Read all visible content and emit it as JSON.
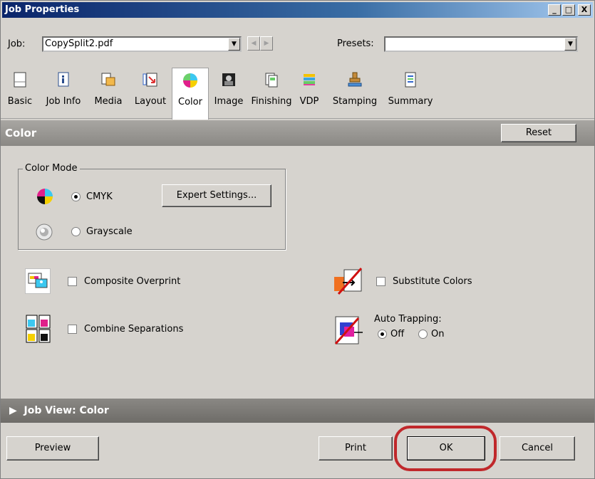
{
  "window": {
    "title": "Job Properties",
    "minimize": "_",
    "maximize": "□",
    "close": "X"
  },
  "job": {
    "label": "Job:",
    "value": "CopySplit2.pdf"
  },
  "presets": {
    "label": "Presets:",
    "value": ""
  },
  "tabs": [
    {
      "label": "Basic",
      "icon": "basic-icon"
    },
    {
      "label": "Job Info",
      "icon": "job-info-icon"
    },
    {
      "label": "Media",
      "icon": "media-icon"
    },
    {
      "label": "Layout",
      "icon": "layout-icon"
    },
    {
      "label": "Color",
      "icon": "color-icon",
      "active": true
    },
    {
      "label": "Image",
      "icon": "image-icon"
    },
    {
      "label": "Finishing",
      "icon": "finishing-icon"
    },
    {
      "label": "VDP",
      "icon": "vdp-icon"
    },
    {
      "label": "Stamping",
      "icon": "stamping-icon"
    },
    {
      "label": "Summary",
      "icon": "summary-icon"
    }
  ],
  "section": {
    "title": "Color",
    "reset_label": "Reset"
  },
  "color_mode": {
    "title": "Color Mode",
    "cmyk_label": "CMYK",
    "grayscale_label": "Grayscale",
    "selected": "CMYK",
    "expert_label": "Expert Settings..."
  },
  "options": {
    "composite_overprint": "Composite Overprint",
    "combine_separations": "Combine Separations",
    "substitute_colors": "Substitute Colors",
    "auto_trapping": {
      "label": "Auto Trapping:",
      "off": "Off",
      "on": "On",
      "selected": "Off"
    }
  },
  "job_view": {
    "label": "Job View: Color"
  },
  "buttons": {
    "preview": "Preview",
    "print": "Print",
    "ok": "OK",
    "cancel": "Cancel"
  },
  "colors": {
    "highlight": "#c0282b",
    "title_bar": "#0a246a"
  }
}
